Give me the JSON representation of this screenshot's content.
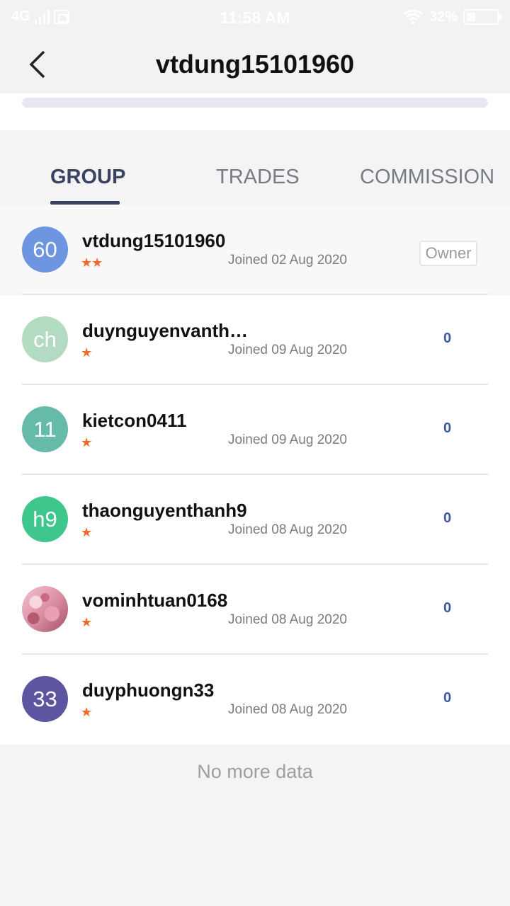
{
  "status_bar": {
    "network": "4G",
    "time": "11:58 AM",
    "battery": "32%"
  },
  "header": {
    "title": "vtdung15101960",
    "back_icon": "chevron-left-icon"
  },
  "tabs": [
    {
      "label": "GROUP",
      "active": true
    },
    {
      "label": "TRADES",
      "active": false
    },
    {
      "label": "COMMISSION",
      "active": false
    }
  ],
  "members": [
    {
      "avatar_text": "60",
      "avatar_color": "#6d95e0",
      "name": "vtdung15101960",
      "stars": "★★",
      "joined": "Joined 02 Aug 2020",
      "badge": "Owner"
    },
    {
      "avatar_text": "ch",
      "avatar_color": "#b2dbc2",
      "name": "duynguyenvantha…",
      "stars": "★",
      "joined": "Joined 09 Aug 2020",
      "count": "0"
    },
    {
      "avatar_text": "11",
      "avatar_color": "#65bba7",
      "name": "kietcon0411",
      "stars": "★",
      "joined": "Joined 09 Aug 2020",
      "count": "0"
    },
    {
      "avatar_text": "h9",
      "avatar_color": "#3fc68c",
      "name": "thaonguyenthanh9",
      "stars": "★",
      "joined": "Joined 08 Aug 2020",
      "count": "0"
    },
    {
      "avatar_text": "",
      "avatar_color": "#e3a4b4",
      "name": "vominhtuan0168",
      "stars": "★",
      "joined": "Joined 08 Aug 2020",
      "count": "0"
    },
    {
      "avatar_text": "33",
      "avatar_color": "#5e55a0",
      "name": "duyphuongn33",
      "stars": "★",
      "joined": "Joined 08 Aug 2020",
      "count": "0"
    }
  ],
  "footer": {
    "no_more": "No more data"
  }
}
